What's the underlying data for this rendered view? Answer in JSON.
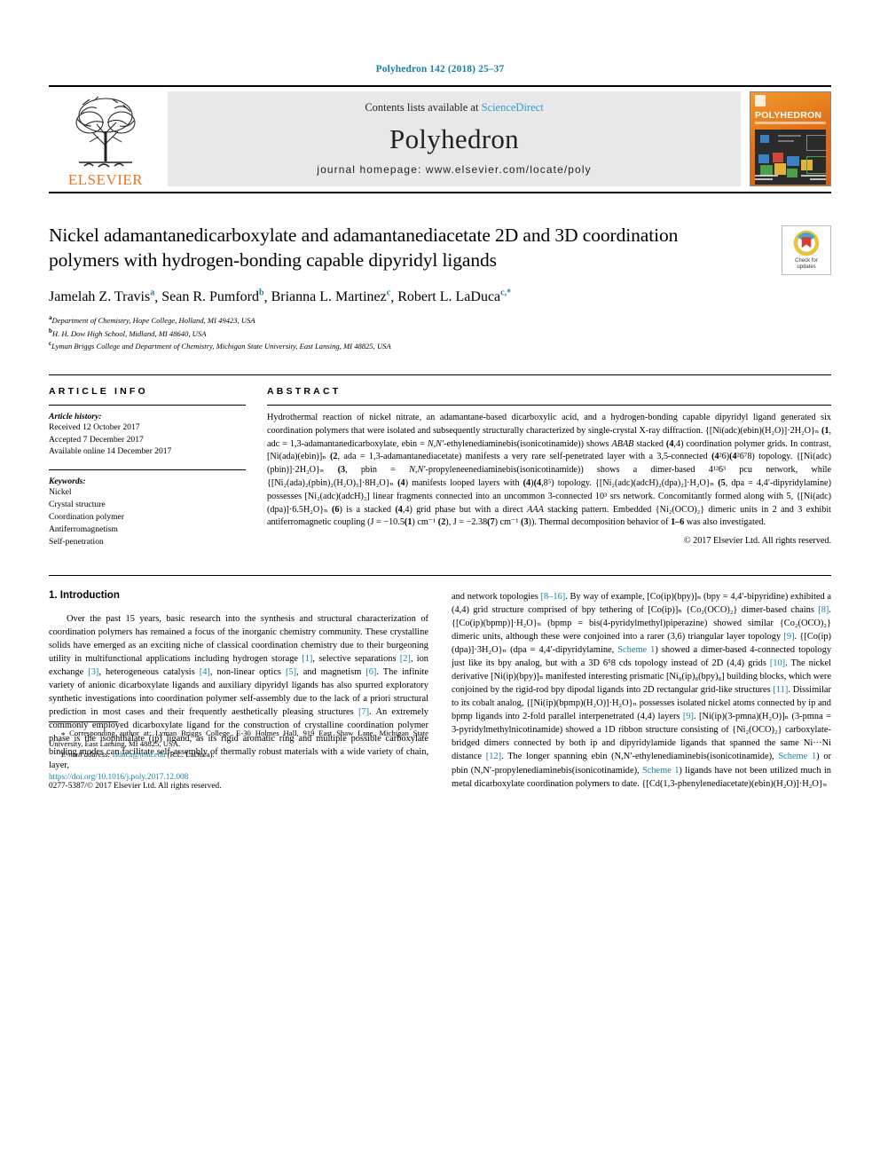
{
  "running_head": "Polyhedron 142 (2018) 25–37",
  "masthead": {
    "publisher": "ELSEVIER",
    "contents_prefix": "Contents lists available at ",
    "contents_link": "ScienceDirect",
    "journal_name": "Polyhedron",
    "homepage": "journal homepage: www.elsevier.com/locate/poly",
    "cover_title": "POLYHEDRON"
  },
  "article": {
    "title": "Nickel adamantanedicarboxylate and adamantanediacetate 2D and 3D coordination polymers with hydrogen-bonding capable dipyridyl ligands",
    "crossmark_line1": "Check for",
    "crossmark_line2": "updates",
    "authors": [
      {
        "name": "Jamelah Z. Travis",
        "sup": "a"
      },
      {
        "name": "Sean R. Pumford",
        "sup": "b"
      },
      {
        "name": "Brianna L. Martinez",
        "sup": "c"
      },
      {
        "name": "Robert L. LaDuca",
        "sup": "c,*"
      }
    ],
    "affiliations": [
      {
        "marker": "a",
        "text": "Department of Chemistry, Hope College, Holland, MI 49423, USA"
      },
      {
        "marker": "b",
        "text": "H. H. Dow High School, Midland, MI 48640, USA"
      },
      {
        "marker": "c",
        "text": "Lyman Briggs College and Department of Chemistry, Michigan State University, East Lansing, MI 48825, USA"
      }
    ]
  },
  "article_info": {
    "heading": "ARTICLE INFO",
    "history_label": "Article history:",
    "history": [
      "Received 12 October 2017",
      "Accepted 7 December 2017",
      "Available online 14 December 2017"
    ],
    "keywords_label": "Keywords:",
    "keywords": [
      "Nickel",
      "Crystal structure",
      "Coordination polymer",
      "Antiferromagnetism",
      "Self-penetration"
    ]
  },
  "abstract": {
    "heading": "ABSTRACT",
    "text": "Hydrothermal reaction of nickel nitrate, an adamantane-based dicarboxylic acid, and a hydrogen-bonding capable dipyridyl ligand generated six coordination polymers that were isolated and subsequently structurally characterized by single-crystal X-ray diffraction. {[Ni(adc)(ebin)(H₂O)]·2H₂O}ₙ (1, adc = 1,3-adamantanedicarboxylate, ebin = N,N′-ethylenediaminebis(isonicotinamide)) shows ABAB stacked (4,4) coordination polymer grids. In contrast, [Ni(ada)(ebin)]ₙ (2, ada = 1,3-adamantanediacetate) manifests a very rare self-penetrated layer with a 3,5-connected (4²6)(4²6⁷8) topology. {[Ni(adc)(pbin)]·2H₂O}ₙ (3, pbin = N,N′-propyleneenediaminebis(isonicotinamide)) shows a dimer-based 4¹²6³ pcu network, while {[Ni₂(ada)₂(pbin)₂(H₂O)₅]·8H₂O}ₙ (4) manifests looped layers with (4)(4,8⁵) topology. {[Ni₂(adc)(adcH)₂(dpa)₂]·H₂O}ₙ (5, dpa = 4,4′-dipyridylamine) possesses [Ni₂(adc)(adcH)₂] linear fragments connected into an uncommon 3-connected 10³ srs network. Concomitantly formed along with 5, {[Ni(adc)(dpa)]·6.5H₂O}ₙ (6) is a stacked (4,4) grid phase but with a direct AAA stacking pattern. Embedded {Ni₂(OCO)₂} dimeric units in 2 and 3 exhibit antiferromagnetic coupling (J = −10.5(1) cm⁻¹ (2), J = −2.38(7) cm⁻¹ (3)). Thermal decomposition behavior of 1–6 was also investigated.",
    "copyright": "© 2017 Elsevier Ltd. All rights reserved."
  },
  "introduction": {
    "heading": "1. Introduction",
    "left_paragraph": "Over the past 15 years, basic research into the synthesis and structural characterization of coordination polymers has remained a focus of the inorganic chemistry community. These crystalline solids have emerged as an exciting niche of classical coordination chemistry due to their burgeoning utility in multifunctional applications including hydrogen storage [1], selective separations [2], ion exchange [3], heterogeneous catalysis [4], non-linear optics [5], and magnetism [6]. The infinite variety of anionic dicarboxylate ligands and auxiliary dipyridyl ligands has also spurred exploratory synthetic investigations into coordination polymer self-assembly due to the lack of a priori structural prediction in most cases and their frequently aesthetically pleasing structures [7]. An extremely commonly employed dicarboxylate ligand for the construction of crystalline coordination polymer phase is the isophthalate (ip) ligand, as its rigid aromatic ring and multiple possible carboxylate binding modes can facilitate self-assembly of thermally robust materials with a wide variety of chain, layer,",
    "right_paragraph": "and network topologies [8–16]. By way of example, [Co(ip)(bpy)]ₙ (bpy = 4,4′-bipyridine) exhibited a (4,4) grid structure comprised of bpy tethering of [Co(ip)]ₙ {Co₂(OCO)₂} dimer-based chains [8]. {[Co(ip)(bpmp)]·H₂O}ₙ (bpmp = bis(4-pyridylmethyl)piperazine) showed similar {Co₂(OCO)₂} dimeric units, although these were conjoined into a rarer (3,6) triangular layer topology [9]. {[Co(ip)(dpa)]·3H₂O}ₙ (dpa = 4,4′-dipyridylamine, Scheme 1) showed a dimer-based 4-connected topology just like its bpy analog, but with a 3D 6⁵8 cds topology instead of 2D (4,4) grids [10]. The nickel derivative [Ni(ip)(bpy)]ₙ manifested interesting prismatic [Ni₈(ip)₈(bpy)₈] building blocks, which were conjoined by the rigid-rod bpy dipodal ligands into 2D rectangular grid-like structures [11]. Dissimilar to its cobalt analog, {[Ni(ip)(bpmp)(H₂O)]·H₂O}ₙ possesses isolated nickel atoms connected by ip and bpmp ligands into 2-fold parallel interpenetrated (4,4) layers [9]. [Ni(ip)(3-pmna)(H₂O)]ₙ (3-pmna = 3-pyridylmethylnicotinamide) showed a 1D ribbon structure consisting of {Ni₂(OCO)₂} carboxylate-bridged dimers connected by both ip and dipyridylamide ligands that spanned the same Ni···Ni distance [12]. The longer spanning ebin (N,N′-ethylenediaminebis(isonicotinamide), Scheme 1) or pbin (N,N′-propylenediaminebis(isonicotinamide), Scheme 1) ligands have not been utilized much in metal dicarboxylate coordination polymers to date. {[Cd(1,3-phenylenediacetate)(ebin)(H₂O)]·H₂O}ₙ"
  },
  "footer": {
    "corresponding_marker": "⁎",
    "corresponding_text": "Corresponding author at: Lyman Briggs College, E-30 Holmes Hall, 919 East Shaw Lane, Michigan State University, East Lansing, MI 48825, USA.",
    "email_label": "E-mail address:",
    "email": "laduca@msu.edu",
    "email_suffix": "(R.L. LaDuca).",
    "doi": "https://doi.org/10.1016/j.poly.2017.12.008",
    "issn": "0277-5387/© 2017 Elsevier Ltd. All rights reserved."
  },
  "colors": {
    "link": "#1a7fa8",
    "elsevier_orange": "#e87722",
    "sciencedirect": "#2a9fd6"
  }
}
